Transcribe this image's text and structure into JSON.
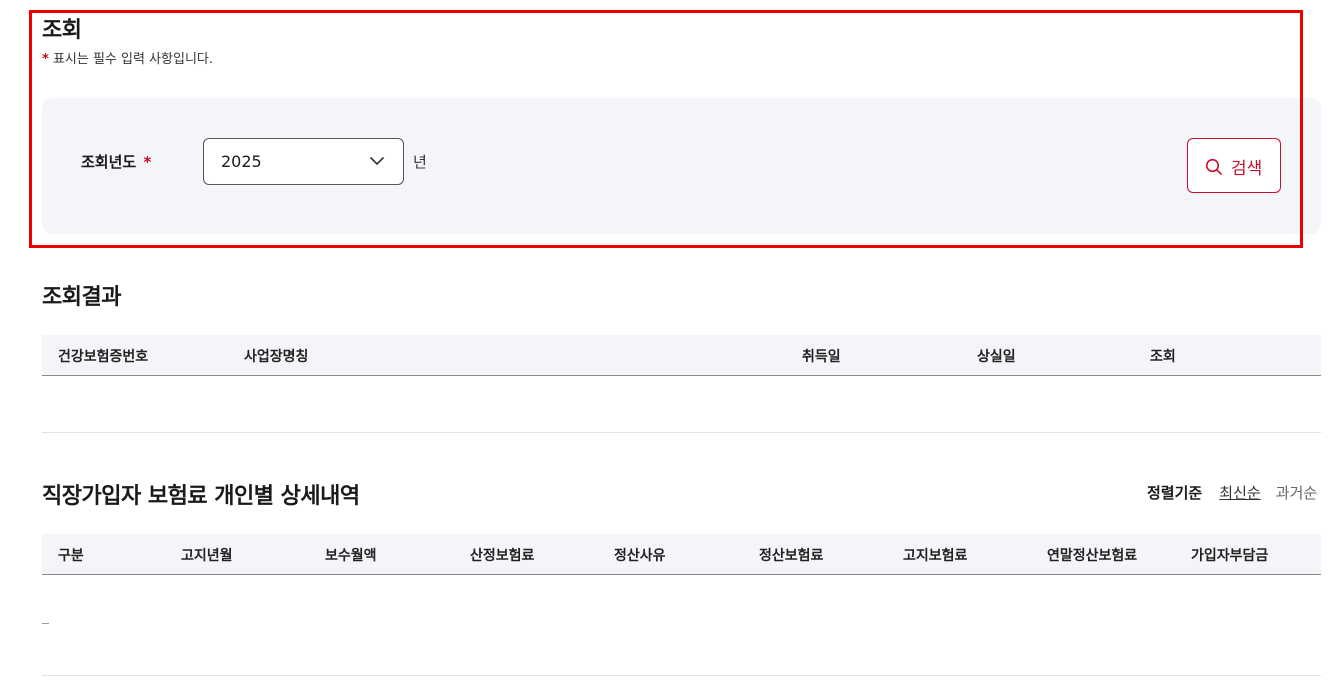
{
  "search_section": {
    "title": "조회",
    "required_star": "*",
    "required_note": "표시는 필수 입력 사항입니다.",
    "year_label": "조회년도",
    "year_value": "2025",
    "year_suffix": "년",
    "search_button": "검색"
  },
  "result_section": {
    "title": "조회결과",
    "columns": [
      "건강보험증번호",
      "사업장명칭",
      "취득일",
      "상실일",
      "조회"
    ]
  },
  "detail_section": {
    "title": "직장가입자 보험료 개인별 상세내역",
    "sort_label": "정렬기준",
    "sort_options": [
      "최신순",
      "과거순"
    ],
    "columns": [
      "구분",
      "고지년월",
      "보수월액",
      "산정보험료",
      "정산사유",
      "정산보험료",
      "고지보험료",
      "연말정산보험료",
      "가입자부담금"
    ]
  },
  "colors": {
    "accent": "#c8102e",
    "highlight_border": "#ee0000",
    "panel_bg": "#f4f5f9"
  }
}
